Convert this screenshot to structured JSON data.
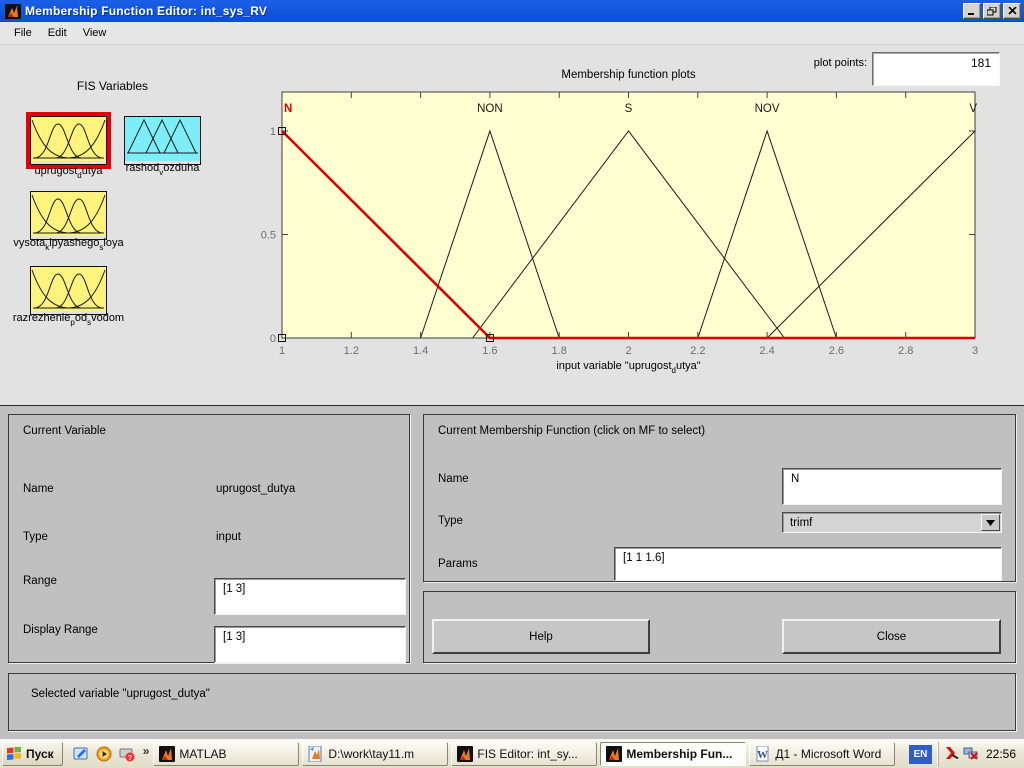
{
  "window": {
    "title": "Membership Function Editor: int_sys_RV",
    "menu": [
      "File",
      "Edit",
      "View"
    ],
    "controls": [
      "minimize",
      "restore",
      "close"
    ],
    "titlebar_color": "#0b52dd"
  },
  "fis_panel": {
    "heading": "FIS Variables",
    "variables": [
      {
        "name": "uprugost_dutya",
        "kind": "curves",
        "color": "#fff27d",
        "selected": true
      },
      {
        "name": "rashod_vozduha",
        "kind": "triangles",
        "color": "#7deef8",
        "selected": false
      },
      {
        "name": "vysota_kipyashego_sloya",
        "kind": "curves",
        "color": "#fff27d",
        "selected": false
      },
      {
        "name": "razrezhenie_pod_svodom",
        "kind": "curves",
        "color": "#fff27d",
        "selected": false
      }
    ],
    "selected_border_color": "#e60000"
  },
  "plot": {
    "points_label": "plot points:",
    "points_value": "181",
    "title": "Membership function plots",
    "xlabel_prefix": "input variable",
    "xlabel_var": "uprugost_dutya",
    "bg_color": "#ffffd1"
  },
  "chart_data": {
    "type": "line",
    "title": "Membership function plots",
    "xlabel": "input variable \"uprugost_dutya\"",
    "ylabel": "",
    "xlim": [
      1,
      3
    ],
    "ylim": [
      0,
      1
    ],
    "xticks": [
      1,
      1.2,
      1.4,
      1.6,
      1.8,
      2,
      2.2,
      2.4,
      2.6,
      2.8,
      3
    ],
    "yticks": [
      0,
      0.5,
      1
    ],
    "grid": false,
    "background": "#ffffd1",
    "series": [
      {
        "name": "NON",
        "mf_type": "trimf",
        "params": [
          1.4,
          1.6,
          1.8
        ],
        "selected": false,
        "color": "#1a1a1a",
        "points": [
          [
            1.4,
            0
          ],
          [
            1.6,
            1
          ],
          [
            1.8,
            0
          ]
        ]
      },
      {
        "name": "S",
        "mf_type": "trimf",
        "params": [
          1.55,
          2,
          2.45
        ],
        "selected": false,
        "color": "#1a1a1a",
        "points": [
          [
            1.55,
            0
          ],
          [
            2,
            1
          ],
          [
            2.45,
            0
          ]
        ]
      },
      {
        "name": "NOV",
        "mf_type": "trimf",
        "params": [
          2.2,
          2.4,
          2.6
        ],
        "selected": false,
        "color": "#1a1a1a",
        "points": [
          [
            2.2,
            0
          ],
          [
            2.4,
            1
          ],
          [
            2.6,
            0
          ]
        ]
      },
      {
        "name": "V",
        "mf_type": "trimf",
        "params": [
          2.4,
          3,
          3
        ],
        "selected": false,
        "color": "#1a1a1a",
        "points": [
          [
            2.4,
            0
          ],
          [
            3,
            1
          ]
        ]
      },
      {
        "name": "N",
        "mf_type": "trimf",
        "params": [
          1,
          1,
          1.6
        ],
        "selected": true,
        "color": "#dd0000",
        "points": [
          [
            1,
            1
          ],
          [
            1.6,
            0
          ],
          [
            3,
            0
          ]
        ]
      }
    ],
    "label_positions": {
      "N": 1,
      "NON": 1.6,
      "S": 2,
      "NOV": 2.4,
      "V": 3
    },
    "handles": [
      [
        1,
        1
      ],
      [
        1,
        0
      ],
      [
        1.6,
        0
      ]
    ]
  },
  "current_variable": {
    "heading": "Current Variable",
    "name_label": "Name",
    "name_value": "uprugost_dutya",
    "type_label": "Type",
    "type_value": "input",
    "range_label": "Range",
    "range_value": "[1 3]",
    "display_range_label": "Display Range",
    "display_range_value": "[1 3]"
  },
  "current_mf": {
    "heading": "Current Membership Function (click on MF to select)",
    "name_label": "Name",
    "name_value": "N",
    "type_label": "Type",
    "type_value": "trimf",
    "params_label": "Params",
    "params_value": "[1 1 1.6]"
  },
  "actions": {
    "help": "Help",
    "close": "Close"
  },
  "status": {
    "text": "Selected variable \"uprugost_dutya\""
  },
  "taskbar": {
    "start_label": "Пуск",
    "quick_launch": [
      "show-desktop",
      "media-player",
      "help-session"
    ],
    "chevron": "»",
    "buttons": [
      {
        "label": "MATLAB",
        "icon": "matlab",
        "active": false
      },
      {
        "label": "D:\\work\\tay11.m",
        "icon": "matlab-file",
        "active": false
      },
      {
        "label": "FIS Editor: int_sy...",
        "icon": "matlab",
        "active": false
      },
      {
        "label": "Membership Fun...",
        "icon": "matlab",
        "active": true
      },
      {
        "label": "Д1 - Microsoft Word",
        "icon": "word",
        "active": false
      }
    ],
    "tray": {
      "lang": "EN",
      "icons": [
        "kaspersky",
        "network-error"
      ],
      "clock": "22:56"
    }
  }
}
